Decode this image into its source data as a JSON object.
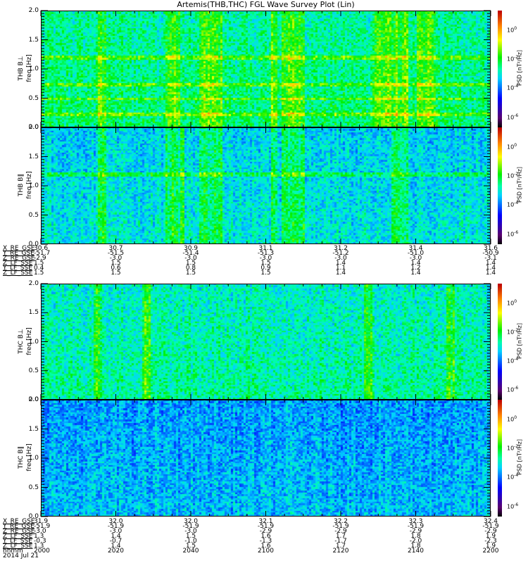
{
  "title": "Artemis(THB,THC) FGL Wave Survey Plot (Lin)",
  "colors": {
    "axis": "#000000",
    "background": "#ffffff"
  },
  "chart_data": {
    "type": "heatmap",
    "title": "Artemis(THB,THC) FGL Wave Survey Plot (Lin)",
    "xlabel": "hhmm",
    "x_ticks": [
      "2000",
      "2020",
      "2040",
      "2100",
      "2120",
      "2140",
      "2200"
    ],
    "xlim_hhmm": [
      "2000",
      "2200"
    ],
    "date": "2014 Jul 21",
    "colorbar": {
      "label": "PSD [nT²/Hz]",
      "scale": "log",
      "range_log10": [
        -6.7,
        1.35
      ],
      "ticks": [
        {
          "base": "10",
          "exp": "0"
        },
        {
          "base": "10",
          "exp": "-2"
        },
        {
          "base": "10",
          "exp": "-4"
        },
        {
          "base": "10",
          "exp": "-6"
        }
      ]
    },
    "panels": [
      {
        "name": "THB B⊥",
        "ylabel": "freq [Hz]",
        "ylim": [
          0,
          2.0
        ],
        "y_ticks": [
          "2.0",
          "1.5",
          "1.0",
          "0.5",
          "0.0"
        ],
        "mean_log10_psd": -2.4,
        "bright_intervals_min_after_2000": [
          [
            15,
            17
          ],
          [
            33,
            37
          ],
          [
            42,
            48
          ],
          [
            61,
            63
          ],
          [
            64,
            70
          ],
          [
            88,
            98
          ],
          [
            100,
            105
          ]
        ],
        "narrowband_hz": [
          0.2,
          0.47,
          0.7,
          1.17
        ]
      },
      {
        "name": "THB B∥",
        "ylabel": "freq [Hz]",
        "ylim": [
          0,
          2.0
        ],
        "y_ticks": [
          "2.0",
          "1.5",
          "1.0",
          "0.5",
          "0.0"
        ],
        "mean_log10_psd": -3.0,
        "bright_intervals_min_after_2000": [
          [
            15,
            17
          ],
          [
            33,
            38
          ],
          [
            42,
            48
          ],
          [
            61,
            63
          ],
          [
            64,
            70
          ],
          [
            93,
            98
          ]
        ],
        "narrowband_hz": [
          1.17
        ]
      },
      {
        "name": "THC B⊥",
        "ylabel": "freq [Hz]",
        "ylim": [
          0,
          2.0
        ],
        "y_ticks": [
          "2.0",
          "1.5",
          "1.0",
          "0.5",
          "0.0"
        ],
        "mean_log10_psd": -2.6,
        "bright_intervals_min_after_2000": [
          [
            14,
            16
          ],
          [
            27,
            29
          ],
          [
            86,
            88
          ],
          [
            108,
            110
          ]
        ],
        "narrowband_hz": []
      },
      {
        "name": "THC B∥",
        "ylabel": "freq [Hz]",
        "ylim": [
          0,
          2.0
        ],
        "y_ticks": [
          "2.0",
          "1.5",
          "1.0",
          "0.5",
          "0.0"
        ],
        "mean_log10_psd": -3.4,
        "bright_intervals_min_after_2000": [],
        "narrowband_hz": []
      }
    ]
  },
  "ephem_thb": {
    "rows": [
      {
        "label": "X_RE_GSE",
        "values": [
          "30.6",
          "30.7",
          "30.9",
          "31.1",
          "31.2",
          "31.4",
          "31.6"
        ]
      },
      {
        "label": "Y_RE_GSE",
        "values": [
          "-51.7",
          "-51.5",
          "-51.4",
          "-51.3",
          "-51.2",
          "-51.0",
          "-50.9"
        ]
      },
      {
        "label": "Z_RE_GSE",
        "values": [
          "-2.9",
          "-3.0",
          "-3.0",
          "-3.0",
          "-3.0",
          "-3.0",
          "-3.1"
        ]
      },
      {
        "label": "Z_LF_SSE",
        "values": [
          "1.5",
          "1.5",
          "1.5",
          "1.5",
          "1.4",
          "1.4",
          "1.4"
        ]
      },
      {
        "label": "Y_LF_SSE",
        "values": [
          "0.4",
          "0.6",
          "0.8",
          "0.9",
          "1.1",
          "1.2",
          "1.4"
        ]
      },
      {
        "label": "Z_LF_SSE",
        "values": [
          "1.5",
          "1.5",
          "1.5",
          "1.5",
          "1.4",
          "1.4",
          "1.4"
        ]
      }
    ]
  },
  "ephem_thc": {
    "rows": [
      {
        "label": "X_RE_GSE",
        "values": [
          "31.9",
          "32.0",
          "32.0",
          "32.1",
          "32.2",
          "32.3",
          "32.4"
        ]
      },
      {
        "label": "Y_RE_GSE",
        "values": [
          "-51.9",
          "-51.9",
          "-51.9",
          "-51.9",
          "-51.9",
          "-51.9",
          "-51.9"
        ]
      },
      {
        "label": "Z_RE_GSE",
        "values": [
          "-3.0",
          "-3.0",
          "-3.0",
          "-2.9",
          "-2.9",
          "-2.9",
          "-2.9"
        ]
      },
      {
        "label": "Z_LF_SSE",
        "values": [
          "1.3",
          "1.4",
          "1.5",
          "1.6",
          "1.7",
          "1.8",
          "1.9"
        ]
      },
      {
        "label": "Y_LF_SSE",
        "values": [
          "-0.3",
          "-0.7",
          "-1.0",
          "-1.3",
          "-1.7",
          "-2.0",
          "-2.3"
        ]
      },
      {
        "label": "Z_LF_SSE",
        "values": [
          "1.3",
          "1.4",
          "1.5",
          "1.6",
          "1.7",
          "1.8",
          "1.9"
        ]
      },
      {
        "label": "hhmm",
        "values": [
          "2000",
          "2020",
          "2040",
          "2100",
          "2120",
          "2140",
          "2200"
        ]
      }
    ],
    "date": "2014 Jul 21"
  }
}
